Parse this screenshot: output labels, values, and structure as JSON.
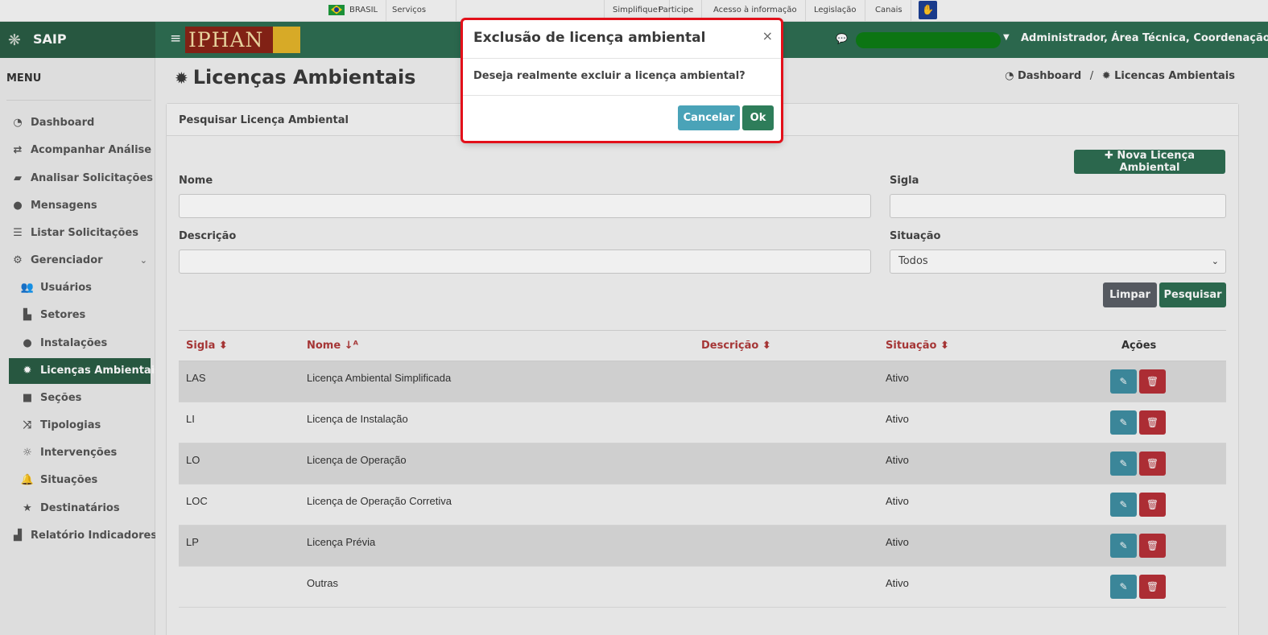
{
  "govbar": {
    "country": "BRASIL",
    "links": [
      "Serviços",
      "Simplifique!",
      "Participe",
      "Acesso à informação",
      "Legislação",
      "Canais"
    ]
  },
  "header": {
    "app_name": "SAIP",
    "logo_text": "IPHAN",
    "user_info": "Administrador, Área Técnica, Coordenação..."
  },
  "sidebar": {
    "title": "MENU",
    "items": [
      {
        "label": "Dashboard",
        "icon": "dashboard-icon"
      },
      {
        "label": "Acompanhar Análise",
        "icon": "exchange-icon"
      },
      {
        "label": "Analisar Solicitações",
        "icon": "book-icon"
      },
      {
        "label": "Mensagens",
        "icon": "comments-icon"
      },
      {
        "label": "Listar Solicitações",
        "icon": "list-icon"
      },
      {
        "label": "Gerenciador",
        "icon": "cogs-icon"
      },
      {
        "label": "Usuários",
        "icon": "users-icon"
      },
      {
        "label": "Setores",
        "icon": "area-chart-icon"
      },
      {
        "label": "Instalações",
        "icon": "circle-icon"
      },
      {
        "label": "Licenças Ambientais",
        "icon": "certificate-icon"
      },
      {
        "label": "Seções",
        "icon": "square-icon"
      },
      {
        "label": "Tipologias",
        "icon": "random-icon"
      },
      {
        "label": "Intervenções",
        "icon": "sun-icon"
      },
      {
        "label": "Situações",
        "icon": "bell-icon"
      },
      {
        "label": "Destinatários",
        "icon": "star-icon"
      },
      {
        "label": "Relatório Indicadores",
        "icon": "chart-icon"
      }
    ]
  },
  "page": {
    "title": "Licenças Ambientais",
    "breadcrumb": {
      "home": "Dashboard",
      "current": "Licencas Ambientais"
    }
  },
  "search": {
    "card_title": "Pesquisar Licença Ambiental",
    "new_button": "Nova Licença Ambiental",
    "nome_label": "Nome",
    "nome_value": "",
    "sigla_label": "Sigla",
    "sigla_value": "",
    "descricao_label": "Descrição",
    "descricao_value": "",
    "situacao_label": "Situação",
    "situacao_selected": "Todos",
    "clear_button": "Limpar",
    "search_button": "Pesquisar"
  },
  "table": {
    "headers": {
      "sigla": "Sigla",
      "nome": "Nome",
      "descricao": "Descrição",
      "situacao": "Situação",
      "acoes": "Ações"
    },
    "rows": [
      {
        "sigla": "LAS",
        "nome": "Licença Ambiental Simplificada",
        "descricao": "",
        "situacao": "Ativo"
      },
      {
        "sigla": "LI",
        "nome": "Licença de Instalação",
        "descricao": "",
        "situacao": "Ativo"
      },
      {
        "sigla": "LO",
        "nome": "Licença de Operação",
        "descricao": "",
        "situacao": "Ativo"
      },
      {
        "sigla": "LOC",
        "nome": "Licença de Operação Corretiva",
        "descricao": "",
        "situacao": "Ativo"
      },
      {
        "sigla": "LP",
        "nome": "Licença Prévia",
        "descricao": "",
        "situacao": "Ativo"
      },
      {
        "sigla": "",
        "nome": "Outras",
        "descricao": "",
        "situacao": "Ativo"
      }
    ]
  },
  "modal": {
    "title": "Exclusão de licença ambiental",
    "close": "×",
    "message": "Deseja realmente excluir a licença ambiental?",
    "cancel": "Cancelar",
    "ok": "Ok"
  },
  "colors": {
    "brand_green": "#2e6e52",
    "danger_red": "#b73038",
    "info_teal": "#4aa3b8",
    "header_sort_red": "#b03a3a",
    "highlight_border": "#e3101a"
  }
}
